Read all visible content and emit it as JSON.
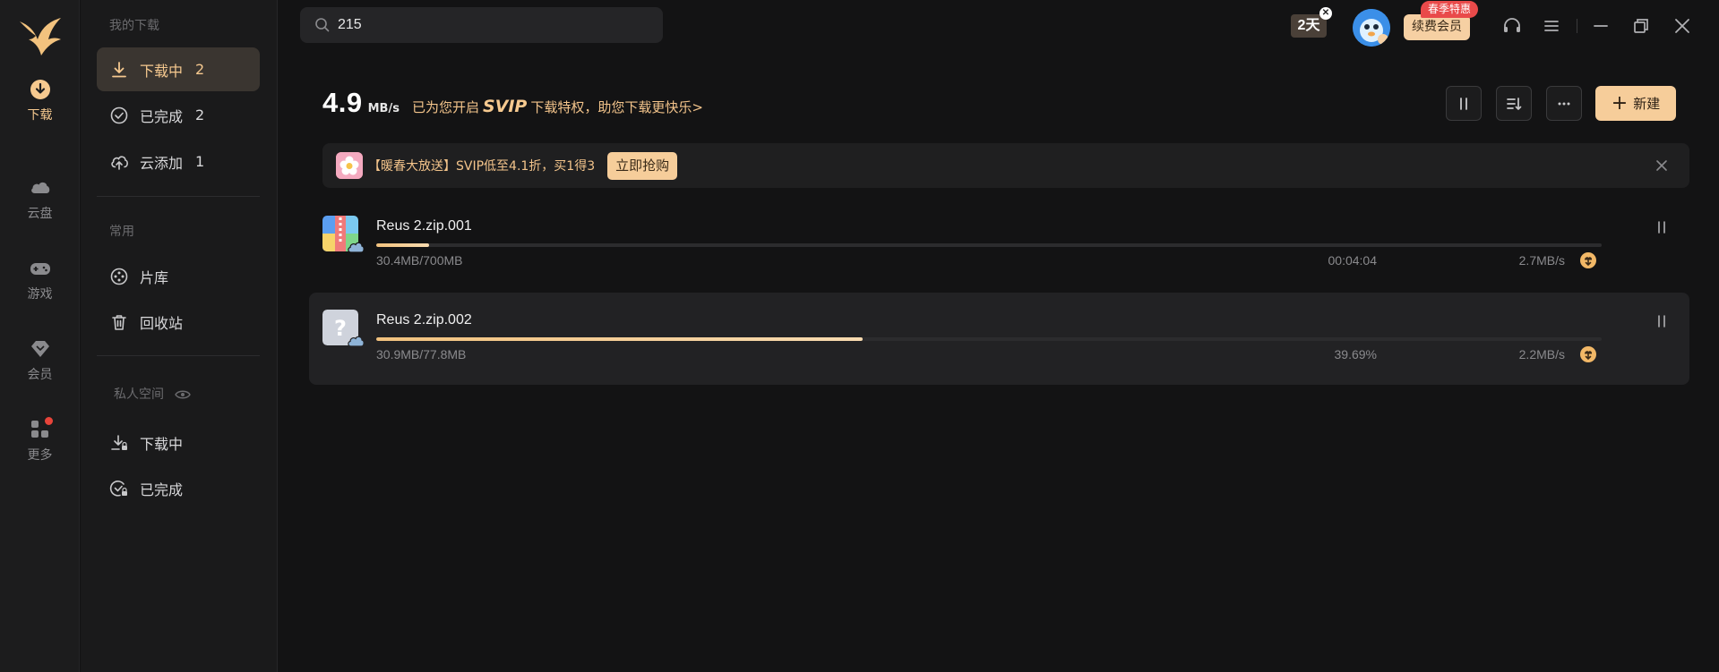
{
  "rail": {
    "items": [
      {
        "label": "下载",
        "icon": "download-circle-icon",
        "active": true
      },
      {
        "label": "云盘",
        "icon": "cloud-icon"
      },
      {
        "label": "游戏",
        "icon": "gamepad-icon"
      },
      {
        "label": "会员",
        "icon": "diamond-icon"
      },
      {
        "label": "更多",
        "icon": "apps-grid-icon"
      }
    ]
  },
  "sidenav": {
    "my_downloads_title": "我的下载",
    "items": [
      {
        "label": "下载中",
        "count": "2"
      },
      {
        "label": "已完成",
        "count": "2"
      },
      {
        "label": "云添加",
        "count": "1"
      }
    ],
    "common_title": "常用",
    "common_items": [
      {
        "label": "片库"
      },
      {
        "label": "回收站"
      }
    ],
    "private_title": "私人空间",
    "private_items": [
      {
        "label": "下载中"
      },
      {
        "label": "已完成"
      }
    ]
  },
  "topbar": {
    "search_value": "215",
    "trial_badge": "2天",
    "renew_label": "续费会员",
    "renew_tag": "春季特惠"
  },
  "main": {
    "speed_value": "4.9",
    "speed_unit": "MB/s",
    "promo_prefix": "已为您开启",
    "promo_brand": "SVIP",
    "promo_suffix": "下载特权，助您下载更快乐>",
    "new_button_label": "新建"
  },
  "banner": {
    "text": "【暖春大放送】SVIP低至4.1折，买1得3",
    "button_label": "立即抢购"
  },
  "tasks": [
    {
      "name": "Reus 2.zip.001",
      "size": "30.4MB/700MB",
      "meta": "00:04:04",
      "speed": "2.7MB/s",
      "progress": 0.0434
    },
    {
      "name": "Reus 2.zip.002",
      "size": "30.9MB/77.8MB",
      "meta": "39.69%",
      "speed": "2.2MB/s",
      "progress": 0.3969
    }
  ],
  "colors": {
    "accent": "#f6c98f",
    "background": "#131314",
    "button_gold": "#f6cd9a",
    "red_dot": "#e8443a"
  }
}
